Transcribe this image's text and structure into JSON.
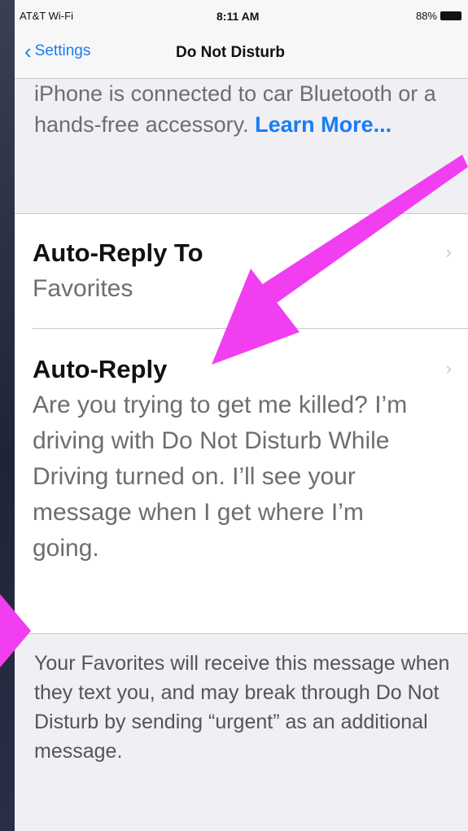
{
  "statusbar": {
    "carrier": "AT&T Wi-Fi",
    "time": "8:11 AM",
    "battery": "88%"
  },
  "navbar": {
    "back_label": "Settings",
    "title": "Do Not Disturb"
  },
  "top_footer": {
    "text": "iPhone is connected to car Bluetooth or a hands-free accessory.",
    "link": "Learn More..."
  },
  "cells": [
    {
      "title": "Auto-Reply To",
      "value": "Favorites"
    },
    {
      "title": "Auto-Reply",
      "value": "Are you trying to get me killed? I’m driving with Do Not Disturb While Driving turned on. I’ll see your message when I get where I’m going."
    }
  ],
  "bottom_footer": {
    "text": "Your Favorites will receive this message when they text you, and may break through Do Not Disturb by sending “urgent” as an additional message."
  },
  "colors": {
    "accent": "#1a7cf5",
    "arrow": "#f13ef0",
    "background": "#efeff4"
  }
}
